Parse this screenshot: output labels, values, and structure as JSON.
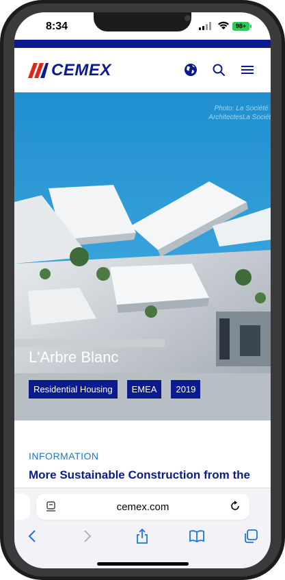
{
  "status_bar": {
    "time": "8:34",
    "battery": "98+"
  },
  "header": {
    "brand": "CEMEX"
  },
  "hero": {
    "credit_line1": "Photo: La Société S",
    "credit_line2": "ArchitectesLa Société",
    "title": "L'Arbre Blanc",
    "tags": [
      "Residential Housing",
      "EMEA",
      "2019"
    ]
  },
  "content": {
    "section_label": "INFORMATION",
    "heading": "More Sustainable Construction from the"
  },
  "browser": {
    "url": "cemex.com"
  },
  "colors": {
    "brand_blue": "#0b1a8e",
    "brand_red": "#e2231a",
    "link_blue": "#1a77d2",
    "safari_blue": "#1a73e8"
  },
  "icons": [
    "globe-icon",
    "search-icon",
    "menu-icon",
    "reader-icon",
    "reload-icon",
    "back-icon",
    "forward-icon",
    "share-icon",
    "bookmarks-icon",
    "tabs-icon"
  ]
}
